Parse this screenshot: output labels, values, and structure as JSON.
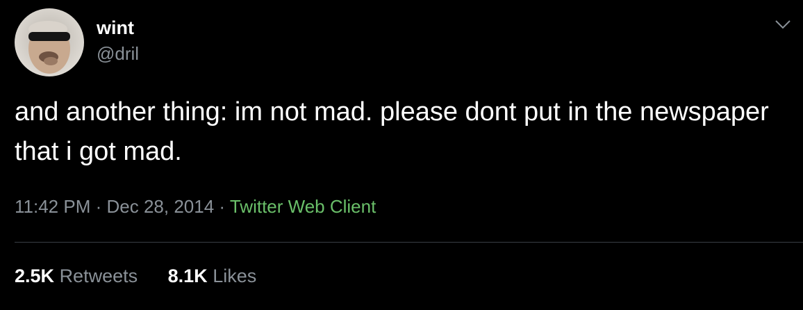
{
  "user": {
    "name": "wint",
    "handle": "@dril"
  },
  "tweet": {
    "text": "and another thing: im not mad. please dont put in the newspaper that i got mad.",
    "time": "11:42 PM",
    "separator": "·",
    "date": "Dec 28, 2014",
    "source": "Twitter Web Client"
  },
  "stats": {
    "retweets_count": "2.5K",
    "retweets_label": "Retweets",
    "likes_count": "8.1K",
    "likes_label": "Likes"
  },
  "icons": {
    "menu": "chevron-down-icon",
    "avatar": "avatar"
  },
  "colors": {
    "background": "#000000",
    "primary_text": "#ffffff",
    "secondary_text": "#8a9198",
    "source_link": "#6abf69",
    "divider": "#3a3f45"
  }
}
